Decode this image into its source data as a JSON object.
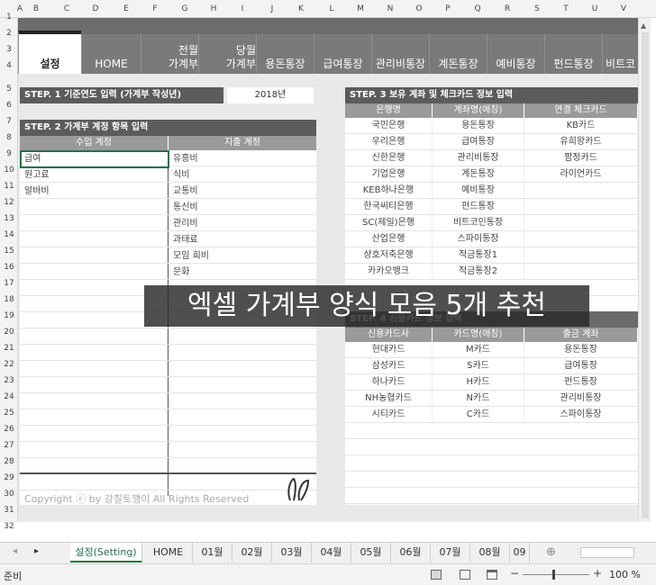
{
  "columns": [
    "A",
    "B",
    "C",
    "D",
    "E",
    "F",
    "G",
    "H",
    "I",
    "J",
    "K",
    "L",
    "M",
    "N",
    "O",
    "P",
    "Q",
    "R",
    "S",
    "T",
    "U",
    "V"
  ],
  "rows": [
    "1",
    "2",
    "3",
    "4",
    "5",
    "6",
    "7",
    "8",
    "9",
    "10",
    "11",
    "12",
    "13",
    "14",
    "15",
    "16",
    "17",
    "18",
    "19",
    "20",
    "21",
    "22",
    "23",
    "24",
    "25",
    "26",
    "27",
    "28",
    "29",
    "30",
    "31",
    "32",
    "33"
  ],
  "nav_tabs": [
    {
      "label": "설정",
      "active": true
    },
    {
      "label": "HOME"
    },
    {
      "label": "전월\n가계부"
    },
    {
      "label": "당월\n가계부"
    },
    {
      "label": "용돈통장"
    },
    {
      "label": "급여통장"
    },
    {
      "label": "관리비통장"
    },
    {
      "label": "계돈통장"
    },
    {
      "label": "예비통장"
    },
    {
      "label": "펀드통장"
    },
    {
      "label": "비트코"
    }
  ],
  "step1": {
    "label": "STEP. 1 기준연도 입력 (가계부 작성년)",
    "year": "2018년"
  },
  "step2": {
    "label": "STEP. 2 가계부 계정 항목 입력",
    "income_header": "수입 계정",
    "expense_header": "지출 계정",
    "income": [
      "급여",
      "원고료",
      "알바비"
    ],
    "expense": [
      "유흥비",
      "식비",
      "교통비",
      "통신비",
      "관리비",
      "과태료",
      "모임 회비",
      "문화"
    ]
  },
  "step3": {
    "label": "STEP. 3 보유 계좌 및 체크카드 정보 입력",
    "headers": [
      "은행명",
      "계좌명(애칭)",
      "연결 체크카드"
    ],
    "rows": [
      [
        "국민은행",
        "용돈통장",
        "KB카드"
      ],
      [
        "우리은행",
        "급여통장",
        "유희왕카드"
      ],
      [
        "신한은행",
        "관리비통장",
        "팜정카드"
      ],
      [
        "기업은행",
        "계돈통장",
        "라이언카드"
      ],
      [
        "KEB하나은행",
        "예비통장",
        ""
      ],
      [
        "한국씨티은행",
        "펀드통장",
        ""
      ],
      [
        "SC(제일)은행",
        "비트코인통장",
        ""
      ],
      [
        "산업은행",
        "스파이통장",
        ""
      ],
      [
        "상호저축은행",
        "적금통장1",
        ""
      ],
      [
        "카카오뱅크",
        "적금통장2",
        ""
      ]
    ]
  },
  "step4": {
    "label": "STEP. 4 신용카드 정보 입력",
    "headers": [
      "신용카드사",
      "카드명(애칭)",
      "출금 계좌"
    ],
    "rows": [
      [
        "현대카드",
        "M카드",
        "용돈통장"
      ],
      [
        "삼성카드",
        "S카드",
        "급여통장"
      ],
      [
        "하나카드",
        "H카드",
        "펀드통장"
      ],
      [
        "NH농협카드",
        "N카드",
        "관리비통장"
      ],
      [
        "시티카드",
        "C카드",
        "스파이통장"
      ]
    ]
  },
  "copyright": "Copyright ⓒ by 강칠토깽이 All Rights Reserved",
  "overlay": "엑셀 가계부 양식 모음 5개 추천",
  "sheet_tabs": [
    {
      "label": "설정(Setting)",
      "active": true
    },
    {
      "label": "HOME"
    },
    {
      "label": "01월"
    },
    {
      "label": "02월"
    },
    {
      "label": "03월"
    },
    {
      "label": "04월"
    },
    {
      "label": "05월"
    },
    {
      "label": "06월"
    },
    {
      "label": "07월"
    },
    {
      "label": "08월"
    },
    {
      "label": "09"
    }
  ],
  "status": {
    "ready": "준비",
    "zoom": "100 %",
    "minus": "−",
    "plus": "+"
  },
  "icons": {
    "nav_left": "◂",
    "nav_right": "▸",
    "add": "⊕"
  },
  "colors": {
    "excel_green": "#217346",
    "band": "#5c5c5c",
    "header_gray": "#9a9a9a",
    "tabbar": "#7a7a7a"
  }
}
